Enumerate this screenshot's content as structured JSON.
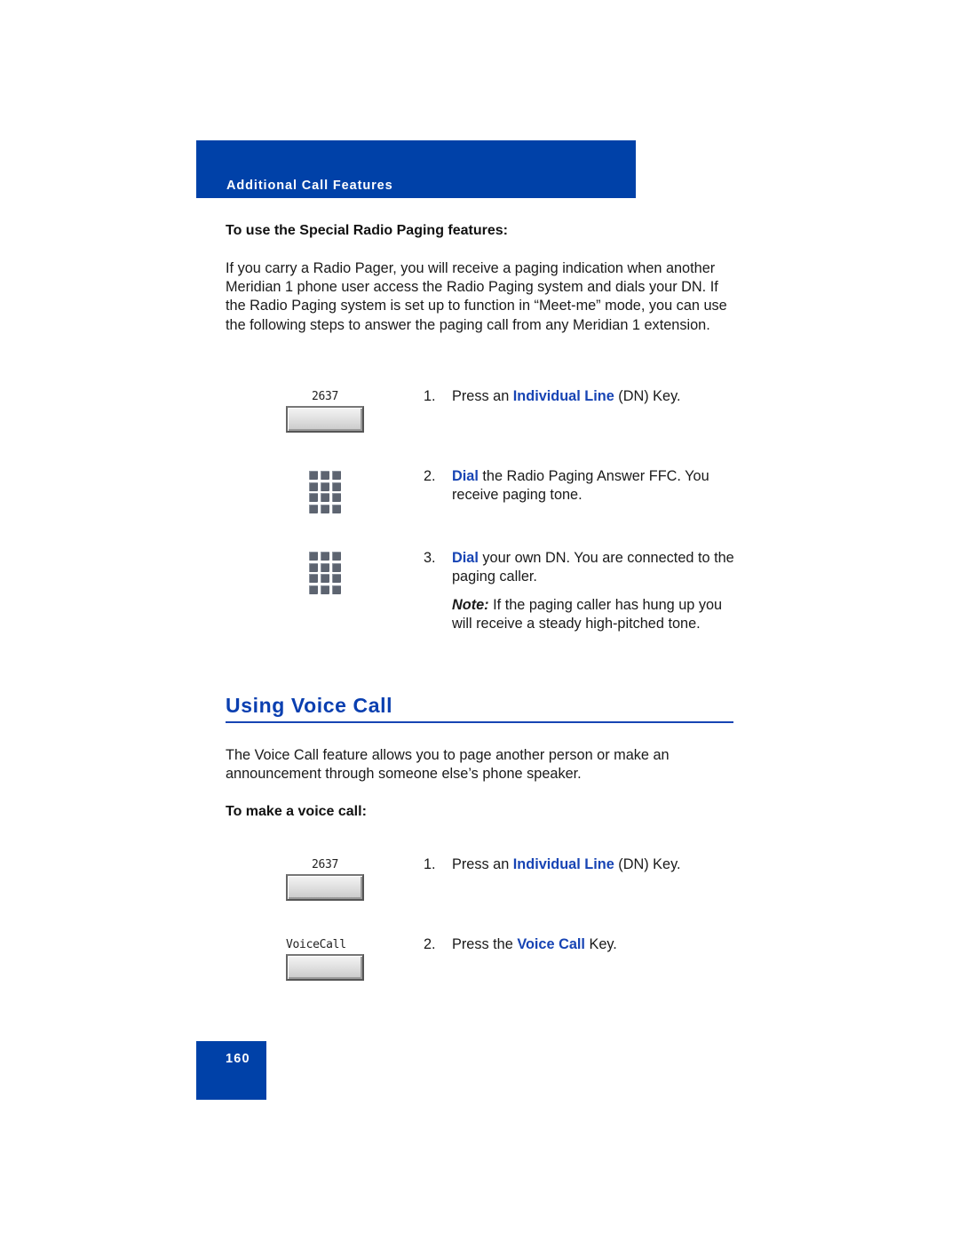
{
  "header": {
    "section_label": "Additional Call Features"
  },
  "radio_paging": {
    "subheading": "To use the Special Radio Paging features:",
    "intro": "If you carry a Radio Pager, you will receive a paging indication when another Meridian 1 phone user access the Radio Paging system and dials your DN. If the Radio Paging system is set up to function in “Meet-me” mode, you can use the following steps to answer the paging call from any Meridian 1 extension.",
    "key_label": "2637",
    "steps": [
      {
        "num": "1.",
        "pre": "Press an ",
        "highlight": "Individual Line",
        "post": " (DN) Key.",
        "icon": "line-key-icon"
      },
      {
        "num": "2.",
        "pre": "",
        "highlight": "Dial",
        "post": " the Radio Paging Answer FFC. You receive paging tone.",
        "icon": "dialpad-icon"
      },
      {
        "num": "3.",
        "pre": "",
        "highlight": "Dial",
        "post": " your own DN. You are connected to the paging caller.",
        "icon": "dialpad-icon"
      }
    ],
    "note": {
      "label": "Note:",
      "text": " If the paging caller has hung up you will receive a steady high-pitched tone."
    }
  },
  "voice_call": {
    "title": "Using Voice Call",
    "intro": "The Voice Call feature allows you to page another person or make an announcement through someone else’s phone speaker.",
    "subheading": "To make a voice call:",
    "key_labels": [
      "2637",
      "VoiceCall"
    ],
    "steps": [
      {
        "num": "1.",
        "pre": "Press an ",
        "highlight": "Individual Line",
        "post": " (DN) Key.",
        "icon": "line-key-icon"
      },
      {
        "num": "2.",
        "pre": "Press the ",
        "highlight": "Voice Call",
        "post": " Key.",
        "icon": "voicecall-key-icon"
      }
    ]
  },
  "footer": {
    "page_number": "160"
  },
  "colors": {
    "brand_blue": "#0041a8",
    "highlight_blue": "#1744b4"
  }
}
